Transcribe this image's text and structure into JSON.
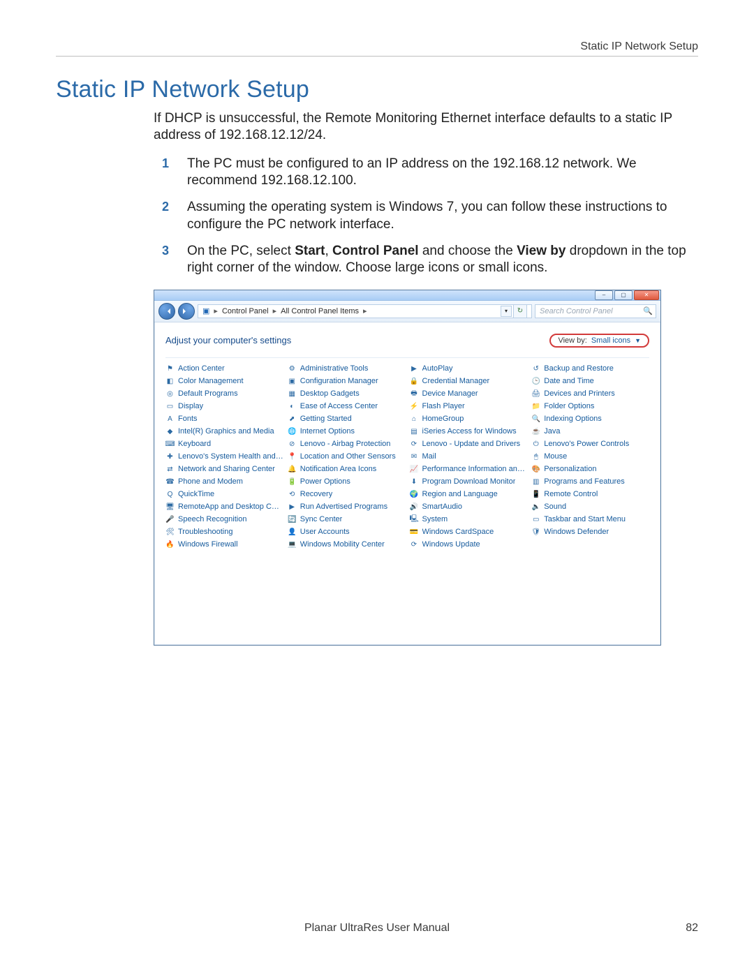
{
  "header": {
    "right": "Static IP Network Setup"
  },
  "title": "Static IP Network Setup",
  "intro": "If DHCP is unsuccessful, the Remote Monitoring Ethernet interface defaults to a static IP address of 192.168.12.12/24.",
  "steps": {
    "s1": "The PC must be configured to an IP address on the 192.168.12 network. We recommend 192.168.12.100.",
    "s2": "Assuming the operating system is Windows 7, you can follow these instructions to configure the PC network interface.",
    "s3_pre": "On the PC, select ",
    "s3_b1": "Start",
    "s3_mid1": ", ",
    "s3_b2": "Control Panel",
    "s3_mid2": " and choose the ",
    "s3_b3": "View by",
    "s3_post": " dropdown in the top right corner of the window. Choose large icons or small icons."
  },
  "cp": {
    "breadcrumb": {
      "a": "Control Panel",
      "b": "All Control Panel Items"
    },
    "search_placeholder": "Search Control Panel",
    "subheading": "Adjust your computer's settings",
    "viewby_label": "View by:",
    "viewby_value": "Small icons",
    "items": [
      {
        "t": "Action Center",
        "i": "⚑",
        "c": "c-green"
      },
      {
        "t": "Administrative Tools",
        "i": "⚙",
        "c": "c-gray"
      },
      {
        "t": "AutoPlay",
        "i": "▶",
        "c": "c-blue"
      },
      {
        "t": "Backup and Restore",
        "i": "↺",
        "c": "c-green"
      },
      {
        "t": "Color Management",
        "i": "◧",
        "c": "c-purple"
      },
      {
        "t": "Configuration Manager",
        "i": "▣",
        "c": "c-blue"
      },
      {
        "t": "Credential Manager",
        "i": "🔒",
        "c": "c-orange"
      },
      {
        "t": "Date and Time",
        "i": "🕒",
        "c": "c-blue"
      },
      {
        "t": "Default Programs",
        "i": "◎",
        "c": "c-blue"
      },
      {
        "t": "Desktop Gadgets",
        "i": "▦",
        "c": "c-blue"
      },
      {
        "t": "Device Manager",
        "i": "🖶",
        "c": "c-gray"
      },
      {
        "t": "Devices and Printers",
        "i": "🖨",
        "c": "c-blue"
      },
      {
        "t": "Display",
        "i": "▭",
        "c": "c-blue"
      },
      {
        "t": "Ease of Access Center",
        "i": "◐",
        "c": "c-blue"
      },
      {
        "t": "Flash Player",
        "i": "⚡",
        "c": "c-red"
      },
      {
        "t": "Folder Options",
        "i": "📁",
        "c": "c-yellow"
      },
      {
        "t": "Fonts",
        "i": "A",
        "c": "c-blue"
      },
      {
        "t": "Getting Started",
        "i": "⬈",
        "c": "c-blue"
      },
      {
        "t": "HomeGroup",
        "i": "⌂",
        "c": "c-green"
      },
      {
        "t": "Indexing Options",
        "i": "🔍",
        "c": "c-blue"
      },
      {
        "t": "Intel(R) Graphics and Media",
        "i": "◆",
        "c": "c-blue"
      },
      {
        "t": "Internet Options",
        "i": "🌐",
        "c": "c-blue"
      },
      {
        "t": "iSeries Access for Windows",
        "i": "▤",
        "c": "c-blue"
      },
      {
        "t": "Java",
        "i": "☕",
        "c": "c-orange"
      },
      {
        "t": "Keyboard",
        "i": "⌨",
        "c": "c-gray"
      },
      {
        "t": "Lenovo - Airbag Protection",
        "i": "⊘",
        "c": "c-red"
      },
      {
        "t": "Lenovo - Update and Drivers",
        "i": "⟳",
        "c": "c-red"
      },
      {
        "t": "Lenovo's Power Controls",
        "i": "⏻",
        "c": "c-red"
      },
      {
        "t": "Lenovo's System Health and Diagno…",
        "i": "✚",
        "c": "c-green"
      },
      {
        "t": "Location and Other Sensors",
        "i": "📍",
        "c": "c-blue"
      },
      {
        "t": "Mail",
        "i": "✉",
        "c": "c-blue"
      },
      {
        "t": "Mouse",
        "i": "🖱",
        "c": "c-gray"
      },
      {
        "t": "Network and Sharing Center",
        "i": "⇄",
        "c": "c-blue"
      },
      {
        "t": "Notification Area Icons",
        "i": "🔔",
        "c": "c-blue"
      },
      {
        "t": "Performance Information and Tools",
        "i": "📈",
        "c": "c-blue"
      },
      {
        "t": "Personalization",
        "i": "🎨",
        "c": "c-blue"
      },
      {
        "t": "Phone and Modem",
        "i": "☎",
        "c": "c-blue"
      },
      {
        "t": "Power Options",
        "i": "🔋",
        "c": "c-green"
      },
      {
        "t": "Program Download Monitor",
        "i": "⬇",
        "c": "c-blue"
      },
      {
        "t": "Programs and Features",
        "i": "▥",
        "c": "c-blue"
      },
      {
        "t": "QuickTime",
        "i": "Q",
        "c": "c-blue"
      },
      {
        "t": "Recovery",
        "i": "⟲",
        "c": "c-green"
      },
      {
        "t": "Region and Language",
        "i": "🌍",
        "c": "c-blue"
      },
      {
        "t": "Remote Control",
        "i": "📱",
        "c": "c-blue"
      },
      {
        "t": "RemoteApp and Desktop Connections",
        "i": "🖥",
        "c": "c-blue"
      },
      {
        "t": "Run Advertised Programs",
        "i": "▶",
        "c": "c-blue"
      },
      {
        "t": "SmartAudio",
        "i": "🔊",
        "c": "c-gray"
      },
      {
        "t": "Sound",
        "i": "🔈",
        "c": "c-gray"
      },
      {
        "t": "Speech Recognition",
        "i": "🎤",
        "c": "c-blue"
      },
      {
        "t": "Sync Center",
        "i": "🔄",
        "c": "c-green"
      },
      {
        "t": "System",
        "i": "🖳",
        "c": "c-blue"
      },
      {
        "t": "Taskbar and Start Menu",
        "i": "▭",
        "c": "c-blue"
      },
      {
        "t": "Troubleshooting",
        "i": "🛠",
        "c": "c-blue"
      },
      {
        "t": "User Accounts",
        "i": "👤",
        "c": "c-blue"
      },
      {
        "t": "Windows CardSpace",
        "i": "💳",
        "c": "c-blue"
      },
      {
        "t": "Windows Defender",
        "i": "🛡",
        "c": "c-blue"
      },
      {
        "t": "Windows Firewall",
        "i": "🔥",
        "c": "c-orange"
      },
      {
        "t": "Windows Mobility Center",
        "i": "💻",
        "c": "c-blue"
      },
      {
        "t": "Windows Update",
        "i": "⟳",
        "c": "c-blue"
      }
    ]
  },
  "footer": {
    "center": "Planar UltraRes User Manual",
    "page": "82"
  }
}
